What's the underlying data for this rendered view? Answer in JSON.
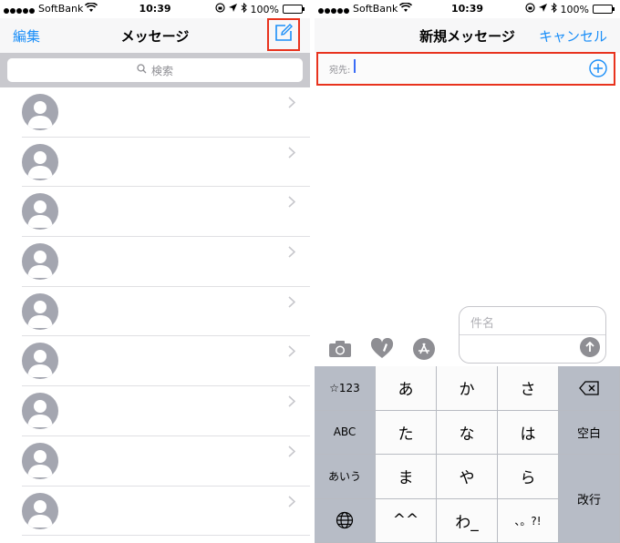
{
  "left": {
    "status": {
      "carrier": "SoftBank",
      "time": "10:39",
      "battery": "100%"
    },
    "nav": {
      "edit": "編集",
      "title": "メッセージ"
    },
    "search": {
      "placeholder": "検索"
    },
    "contacts_count": 9,
    "icons": [
      "compose-icon",
      "search-icon",
      "avatar-icon",
      "chevron-right-icon"
    ]
  },
  "right": {
    "status": {
      "carrier": "SoftBank",
      "time": "10:39",
      "battery": "100%"
    },
    "nav": {
      "title": "新規メッセージ",
      "cancel": "キャンセル"
    },
    "to_label": "宛先:",
    "subject_placeholder": "件名",
    "keyboard": {
      "rows": [
        [
          "☆123",
          "あ",
          "か",
          "さ",
          "⌫"
        ],
        [
          "ABC",
          "た",
          "な",
          "は",
          "空白"
        ],
        [
          "あいう",
          "ま",
          "や",
          "ら",
          "改行"
        ],
        [
          "🌐",
          "^^",
          "わ_",
          "、。?!"
        ]
      ]
    },
    "icons": [
      "camera-icon",
      "digital-touch-icon",
      "app-store-icon",
      "send-arrow-icon",
      "add-contact-icon",
      "backspace-icon",
      "globe-icon"
    ]
  },
  "colors": {
    "accent": "#1a8ef8",
    "highlight": "#e8331e",
    "avatar": "#a4a6b0"
  }
}
